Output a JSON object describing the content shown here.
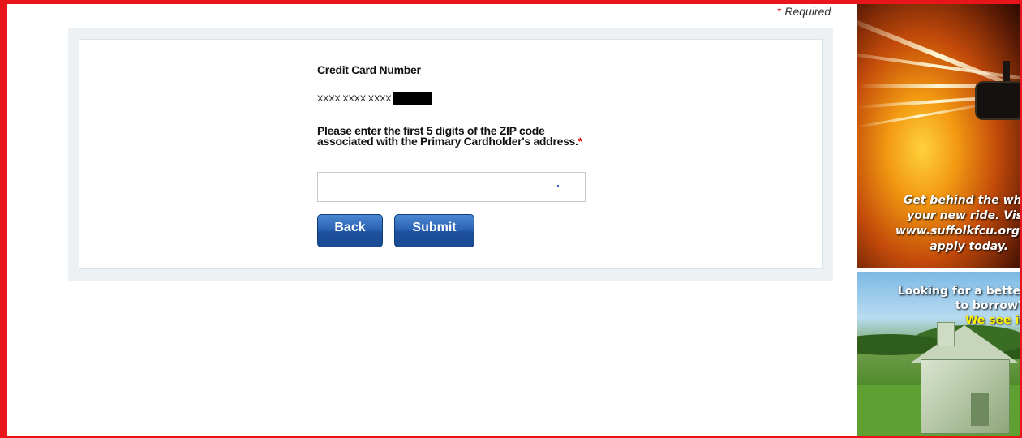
{
  "form": {
    "required_star": "*",
    "required_note": "Required",
    "cc_label": "Credit Card Number",
    "cc_masked": "XXXX XXXX XXXX",
    "zip_label": "Please enter the first 5 digits of the ZIP code associated with the Primary Cardholder's address.",
    "zip_value": "",
    "back_label": "Back",
    "submit_label": "Submit"
  },
  "ads": {
    "auto_loan": {
      "line1": "Get behind the whe",
      "line2": "your new ride. Vis",
      "line3": "www.suffolkfcu.org",
      "line4": "apply today."
    },
    "home_loan": {
      "line1": "Looking for a better",
      "line2_prefix": "to borrow?",
      "line2_highlight": "We see it"
    }
  },
  "colors": {
    "frame": "#e8161b",
    "button_blue": "#2c64b4",
    "required_red": "#d7141a"
  }
}
